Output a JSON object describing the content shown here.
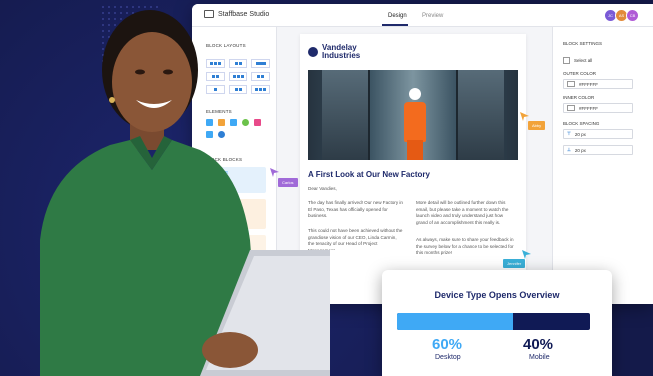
{
  "app": {
    "brand": "Staffbase Studio",
    "tabs": [
      {
        "label": "Design",
        "active": true
      },
      {
        "label": "Preview",
        "active": false
      }
    ],
    "avatars": [
      {
        "initials": "JC",
        "color": "#7a5ad6"
      },
      {
        "initials": "AS",
        "color": "#e28a3a"
      },
      {
        "initials": "CB",
        "color": "#b05ad6"
      }
    ]
  },
  "left_panel": {
    "block_layouts_label": "BLOCK LAYOUTS",
    "elements_label": "ELEMENTS",
    "quick_blocks_label": "QUICK BLOCKS",
    "quick_block_text": "TITLE"
  },
  "newsletter": {
    "logo": "Vandelay Industries",
    "headline": "A First Look at Our New Factory",
    "greeting": "Dear Vandies,",
    "col1_p1": "The day has finally arrived! Our new Factory in El Paso, Texas has officially opened for business.",
    "col1_p2": "This could not have been achieved without the grandiose vision of our CEO, Linda Carmin, the tenacity of our Head of Project Management",
    "col2_p1": "More detail will be outlined further down this email, but please take a moment to watch the launch video and truly understand just how grand of an accomplishment this really is.",
    "col2_p2": "As always, make sure to share your feedback in the survey below for a chance to be selected for this months prize!",
    "col2_p3": "The Survey"
  },
  "right_panel": {
    "block_settings": "BLOCK SETTINGS",
    "select_all": "Select all",
    "outer_color_label": "OUTER COLOR",
    "outer_color_value": "#FFFFFF",
    "inner_color_label": "INNER COLOR",
    "inner_color_value": "#FFFFFF",
    "block_spacing_label": "BLOCK SPACING",
    "spacing_1": "20 px",
    "spacing_2": "20 px"
  },
  "cursors": [
    {
      "name": "Carlos",
      "color": "#a06ad8"
    },
    {
      "name": "Abby",
      "color": "#f2a33a"
    },
    {
      "name": "Jennifer",
      "color": "#3ab0d8"
    }
  ],
  "overview_card": {
    "title": "Device Type Opens Overview",
    "desktop_pct": "60%",
    "desktop_label": "Desktop",
    "desktop_value": 60,
    "mobile_pct": "40%",
    "mobile_label": "Mobile",
    "mobile_value": 40,
    "desktop_color": "#3fa9f5",
    "mobile_color": "#101a55"
  }
}
